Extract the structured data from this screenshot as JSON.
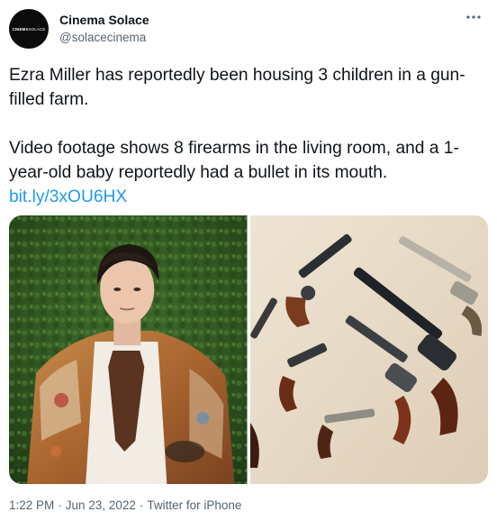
{
  "account": {
    "avatar_logo": "CINEMA SOLACE",
    "avatar_logo_bold": "CINEMA",
    "avatar_logo_light": "SOLACE",
    "display_name": "Cinema Solace",
    "handle": "@solacecinema"
  },
  "tweet": {
    "line1": "Ezra Miller has reportedly been housing 3 children in a gun-filled farm.",
    "line2": "Video footage shows 8 firearms in the living room, and a 1-year-old baby reportedly had a bullet in its mouth.",
    "link": "bit.ly/3xOU6HX"
  },
  "footer": {
    "time": "1:22 PM",
    "separator": "·",
    "date": "Jun 23, 2022",
    "source": "Twitter for iPhone"
  },
  "icons": {
    "more": "more-horizontal-icon"
  },
  "colors": {
    "link": "#1d9bf0",
    "secondary_text": "#536471",
    "primary_text": "#0f1419"
  }
}
